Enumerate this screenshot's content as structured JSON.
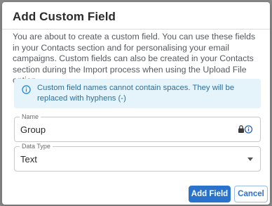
{
  "dialog": {
    "title": "Add Custom Field",
    "intro": "You are about to create a custom field. You can use these fields in your Contacts section and for personalising your email campaigns. Custom fields can also be created in your Contacts section during the Import process when using the Upload File option."
  },
  "alert": {
    "icon": "info-icon",
    "text": "Custom field names cannot contain spaces. They will be replaced with hyphens (-)"
  },
  "name_field": {
    "label": "Name",
    "value": "Group",
    "icon": "password-manager-icon"
  },
  "type_field": {
    "label": "Data Type",
    "value": "Text",
    "icon": "caret-down-icon"
  },
  "buttons": {
    "add_label": "Add Field",
    "cancel_label": "Cancel"
  },
  "colors": {
    "primary": "#2a73cc",
    "alert_bg": "#e5f3fb",
    "alert_text": "#2f6f97"
  }
}
